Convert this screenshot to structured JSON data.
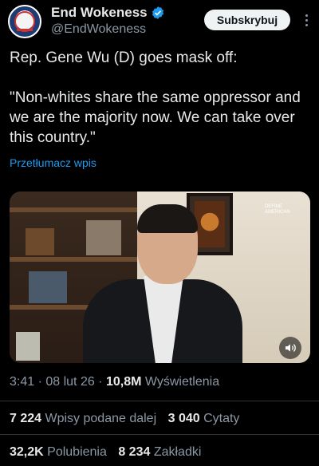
{
  "author": {
    "display_name": "End Wokeness",
    "handle": "@EndWokeness",
    "verified_icon": "verified-badge-icon",
    "avatar_icon": "avatar-logo"
  },
  "actions": {
    "subscribe_label": "Subskrybuj",
    "more_icon": "more-options-icon"
  },
  "tweet": {
    "line1": "Rep. Gene Wu (D) goes mask off:",
    "line2": "\"Non-whites share the same oppressor and we are the majority now. We can take over this country.\"",
    "translate_label": "Przetłumacz wpis"
  },
  "media": {
    "brand_line1": "DEFINE",
    "brand_line2": "AMERICAN",
    "sound_icon": "sound-toggle-icon"
  },
  "meta": {
    "time": "3:41",
    "sep1": " · ",
    "date": "08 lut 26",
    "sep2": " · ",
    "views_count": "10,8M",
    "views_label": " Wyświetlenia"
  },
  "stats": {
    "reposts_count": "7 224",
    "reposts_label": " Wpisy podane dalej",
    "quotes_count": "3 040",
    "quotes_label": " Cytaty",
    "likes_count": "32,2K",
    "likes_label": " Polubienia",
    "bookmarks_count": "8 234",
    "bookmarks_label": " Zakładki"
  },
  "colors": {
    "background": "#000000",
    "text_primary": "#e7e9ea",
    "text_secondary": "#8b98a5",
    "link": "#1d9bf0",
    "verified": "#1d9bf0"
  }
}
